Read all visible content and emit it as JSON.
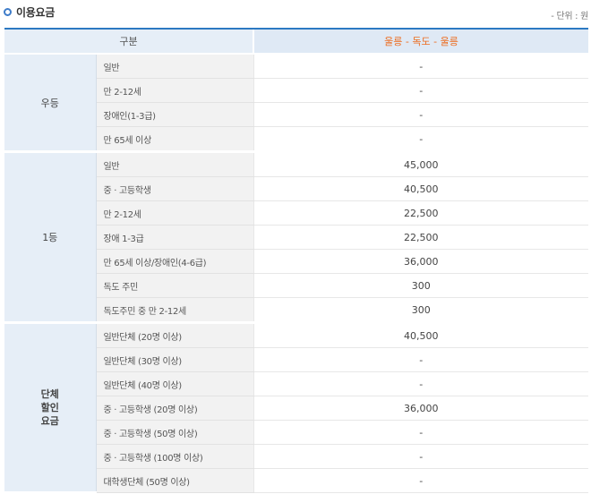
{
  "section_title": "이용요금",
  "unit_note": "- 단위 : 원",
  "headers": {
    "category": "구분",
    "route": "울릉 - 독도 - 울릉"
  },
  "groups": [
    {
      "name": "우등",
      "rows": [
        {
          "label": "일반",
          "price": "-"
        },
        {
          "label": "만 2-12세",
          "price": "-"
        },
        {
          "label": "장애인(1-3급)",
          "price": "-"
        },
        {
          "label": "만 65세 이상",
          "price": "-"
        }
      ]
    },
    {
      "name": "1등",
      "rows": [
        {
          "label": "일반",
          "price": "45,000"
        },
        {
          "label": "중 · 고등학생",
          "price": "40,500"
        },
        {
          "label": "만 2-12세",
          "price": "22,500"
        },
        {
          "label": "장애 1-3급",
          "price": "22,500"
        },
        {
          "label": "만 65세 이상/장애인(4-6급)",
          "price": "36,000"
        },
        {
          "label": "독도 주민",
          "price": "300"
        },
        {
          "label": "독도주민 중 만 2-12세",
          "price": "300"
        }
      ]
    },
    {
      "name": "단체할인요금",
      "name_lines": [
        "단체",
        "할인",
        "요금"
      ],
      "rows": [
        {
          "label": "일반단체 (20명 이상)",
          "price": "40,500"
        },
        {
          "label": "일반단체 (30명 이상)",
          "price": "-"
        },
        {
          "label": "일반단체 (40명 이상)",
          "price": "-"
        },
        {
          "label": "중 · 고등학생 (20명 이상)",
          "price": "36,000"
        },
        {
          "label": "중 · 고등학생 (50명 이상)",
          "price": "-"
        },
        {
          "label": "중 · 고등학생 (100명 이상)",
          "price": "-"
        },
        {
          "label": "대학생단체 (50명 이상)",
          "price": "-"
        }
      ]
    }
  ]
}
